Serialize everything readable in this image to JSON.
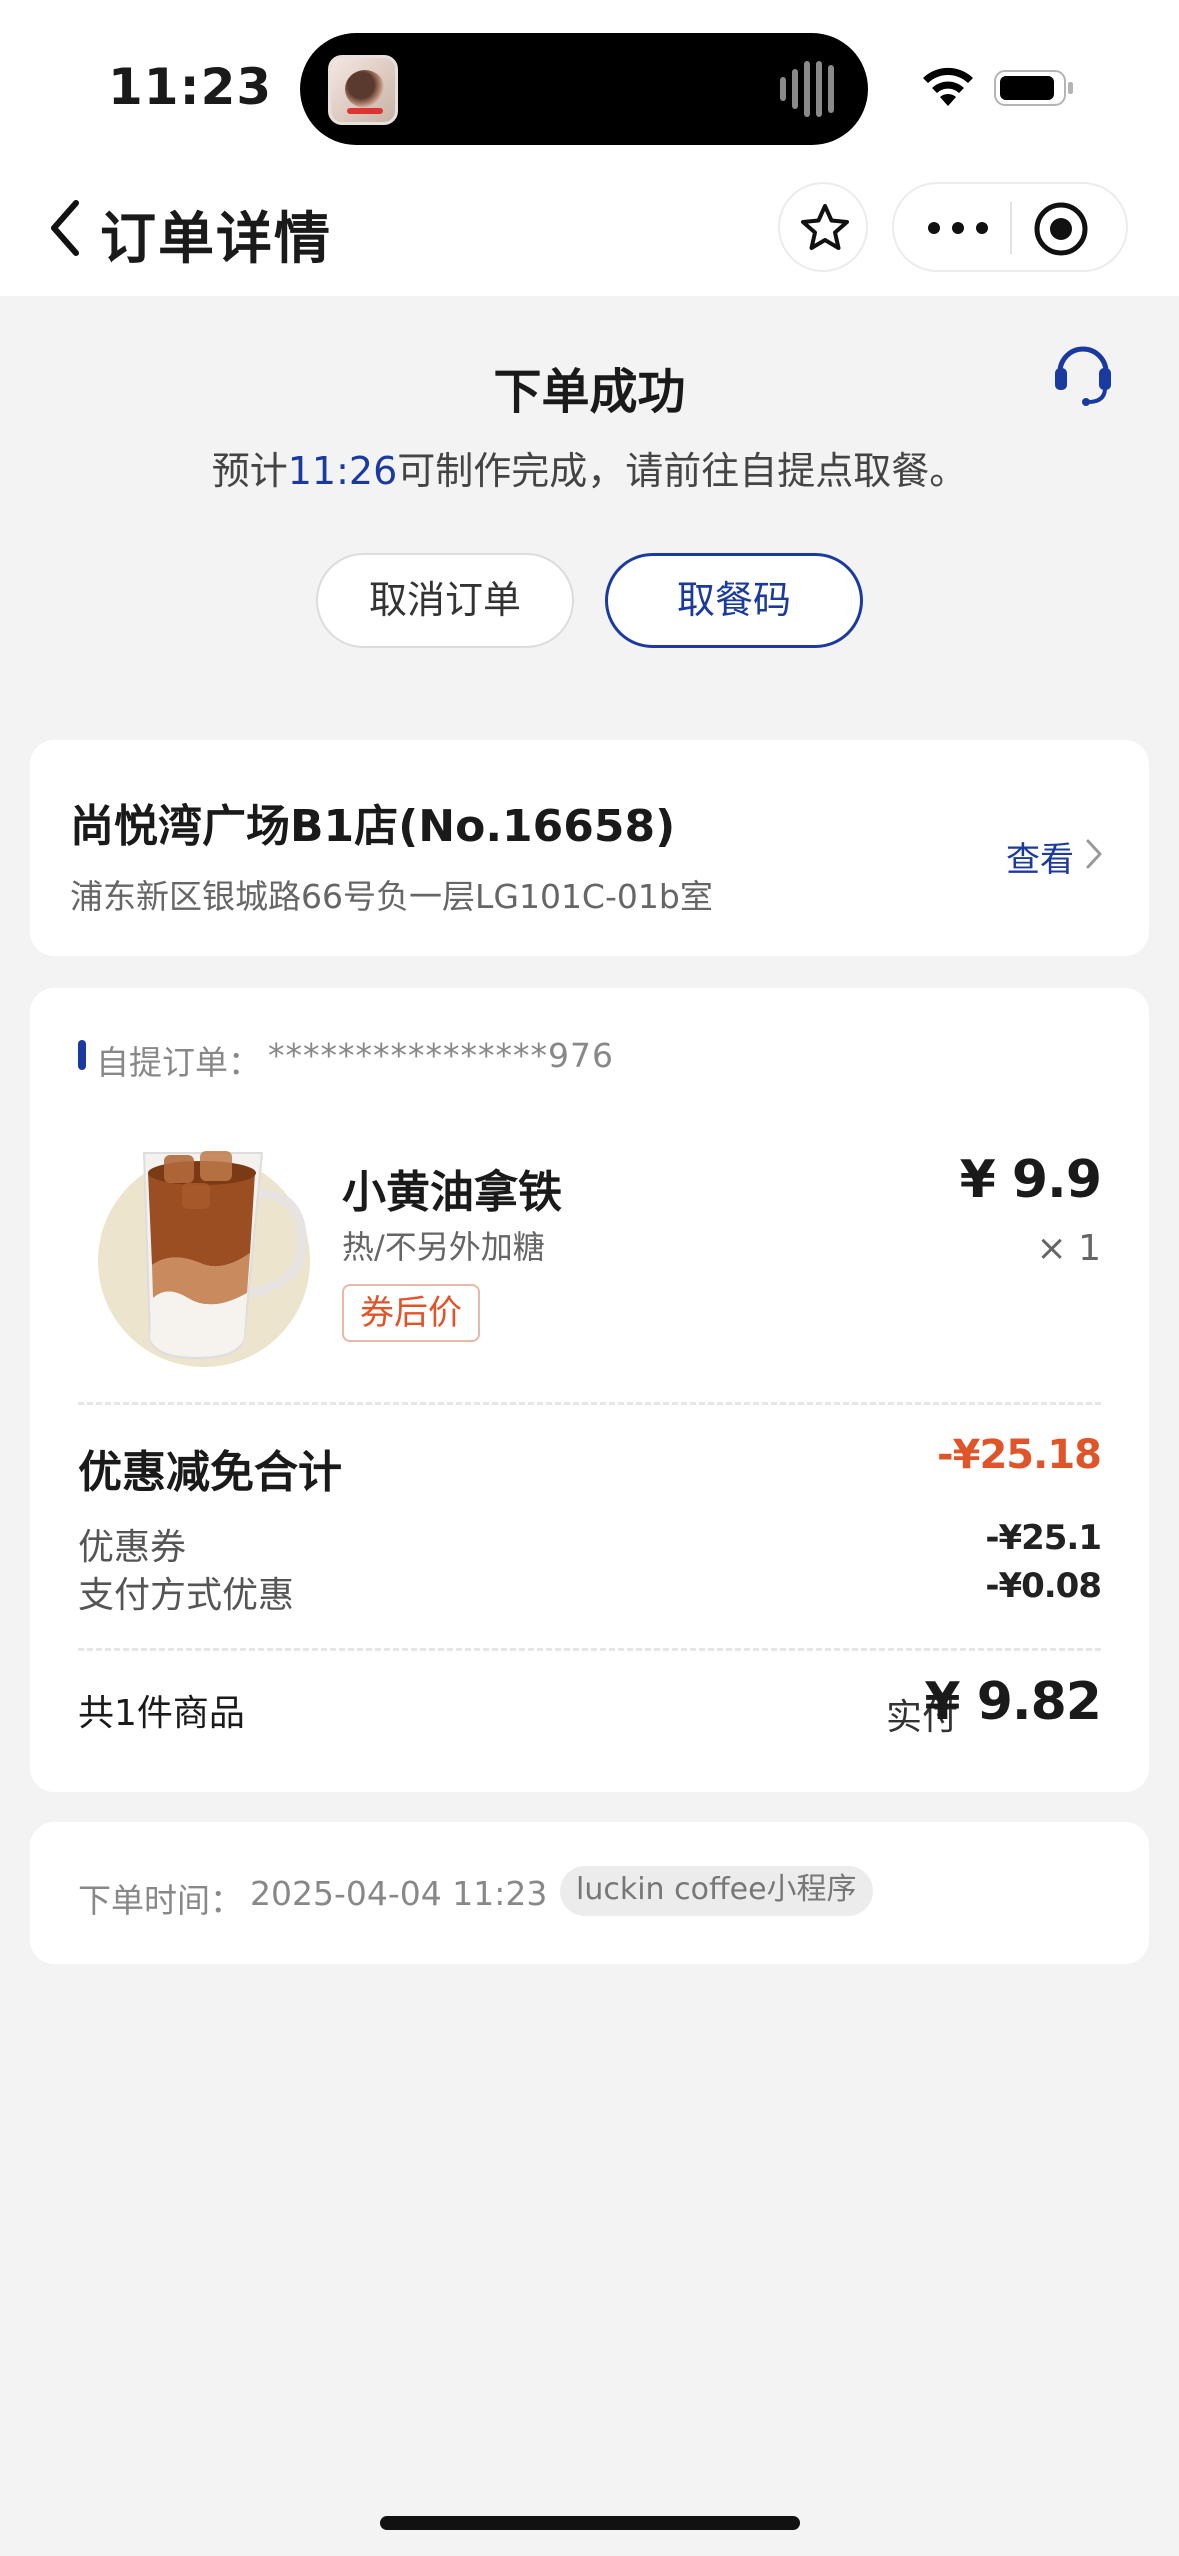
{
  "status_bar": {
    "time": "11:23"
  },
  "nav": {
    "title": "订单详情"
  },
  "order_status": {
    "title": "下单成功",
    "msg_prefix": "预计",
    "eta": "11:26",
    "msg_suffix": "可制作完成，请前往自提点取餐。",
    "cancel_label": "取消订单",
    "pickup_code_label": "取餐码"
  },
  "store": {
    "name": "尚悦湾广场B1店(No.16658)",
    "address": "浦东新区银城路66号负一层LG101C-01b室",
    "view_label": "查看"
  },
  "order": {
    "type_label": "自提订单：",
    "order_number": "****************976",
    "product": {
      "name": "小黄油拿铁",
      "spec": "热/不另外加糖",
      "tag": "券后价",
      "price": "¥ 9.9",
      "quantity": "× 1"
    },
    "discount": {
      "title": "优惠减免合计",
      "total": "-¥25.18",
      "rows": [
        {
          "label": "优惠券",
          "value": "-¥25.1"
        },
        {
          "label": "支付方式优惠",
          "value": "-¥0.08"
        }
      ]
    },
    "items_count": "共1件商品",
    "paid_label": "实付",
    "paid_amount": "¥ 9.82"
  },
  "order_meta": {
    "time_label": "下单时间：",
    "time_value": "2025-04-04 11:23",
    "source": "luckin coffee小程序"
  },
  "colors": {
    "accent_blue": "#1a3aa0",
    "discount_red": "#e0542a",
    "background": "#f3f3f3"
  }
}
